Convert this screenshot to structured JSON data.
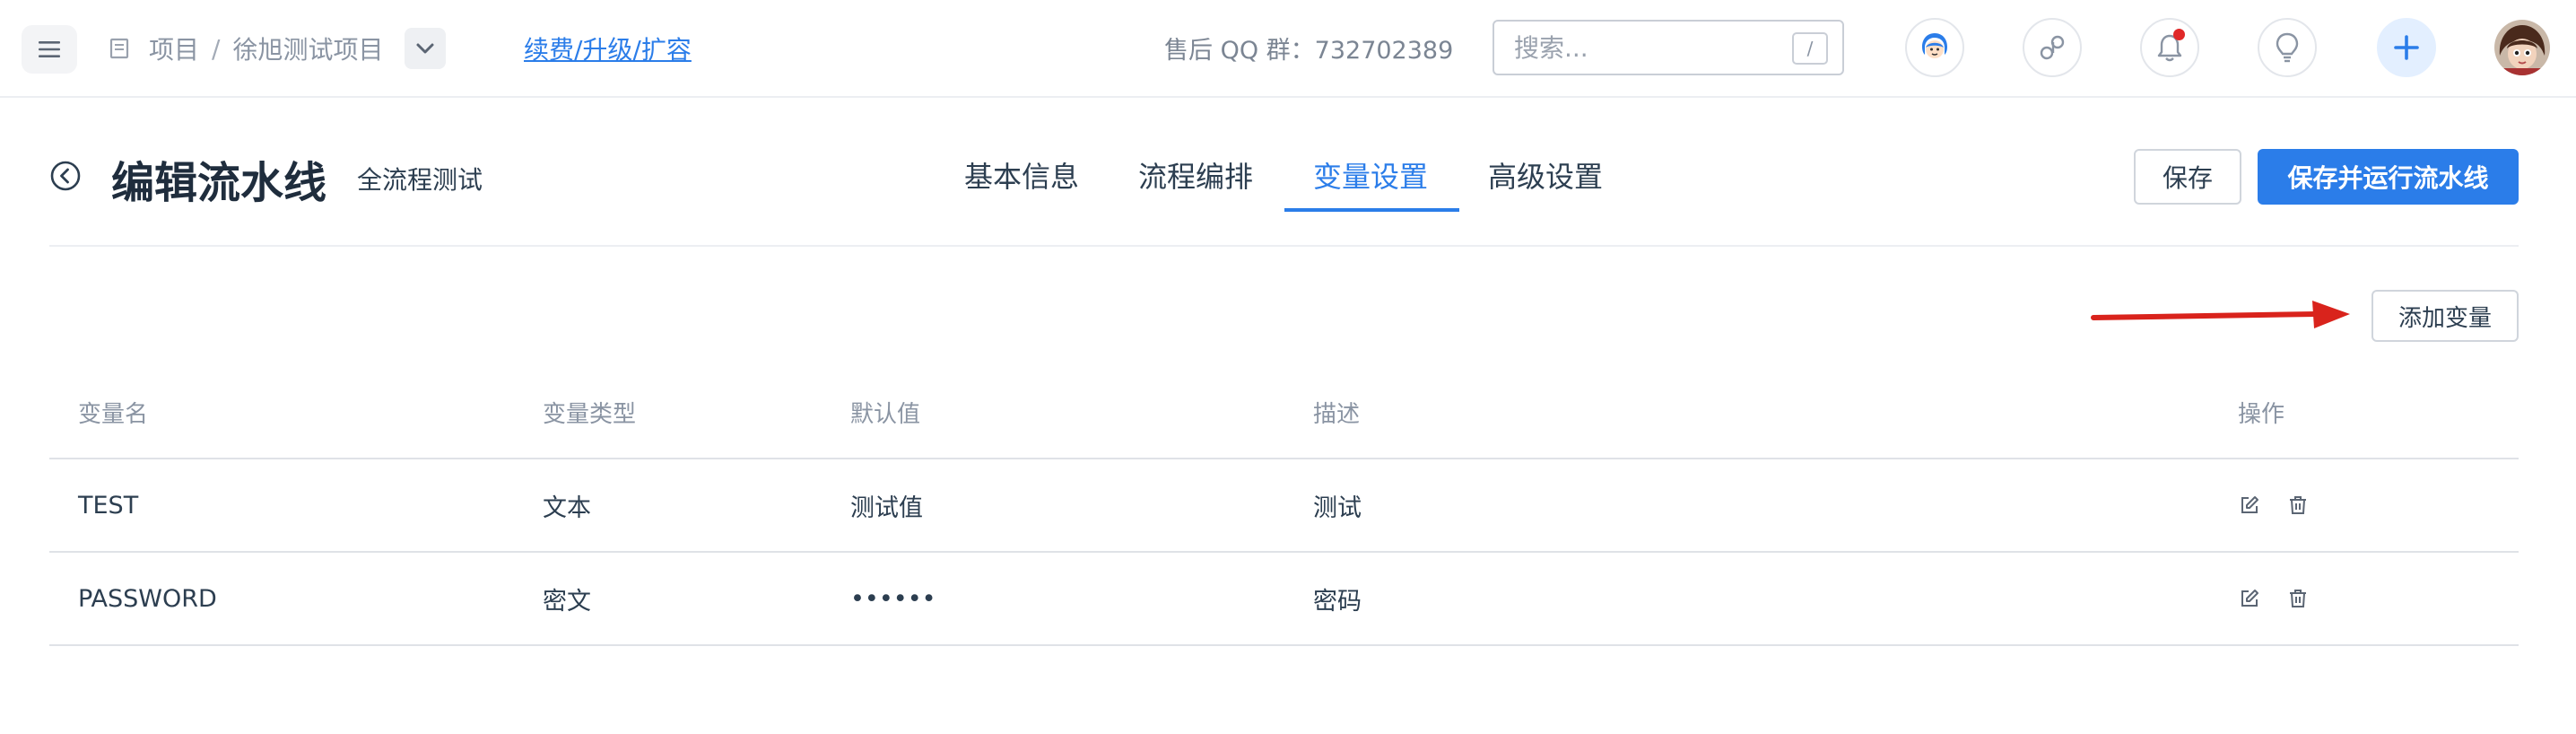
{
  "topbar": {
    "breadcrumb_root": "项目",
    "breadcrumb_sep": "/",
    "project_name": "徐旭测试项目",
    "renew_link": "续费/升级/扩容",
    "support_qq": "售后 QQ 群：732702389",
    "search_placeholder": "搜索...",
    "search_shortcut": "/",
    "icons": [
      "menu-icon",
      "project-icon",
      "chevron-down-icon",
      "customer-service-icon",
      "link-icon",
      "bell-icon",
      "lightbulb-icon",
      "plus-icon",
      "avatar"
    ],
    "notification_dot_color": "#e02828"
  },
  "header": {
    "title": "编辑流水线",
    "subtitle": "全流程测试",
    "tabs": [
      {
        "label": "基本信息",
        "active": false
      },
      {
        "label": "流程编排",
        "active": false
      },
      {
        "label": "变量设置",
        "active": true
      },
      {
        "label": "高级设置",
        "active": false
      }
    ],
    "save_label": "保存",
    "save_run_label": "保存并运行流水线"
  },
  "variables": {
    "add_label": "添加变量",
    "columns": [
      "变量名",
      "变量类型",
      "默认值",
      "描述",
      "操作"
    ],
    "rows": [
      {
        "name": "TEST",
        "type": "文本",
        "default": "测试值",
        "desc": "测试"
      },
      {
        "name": "PASSWORD",
        "type": "密文",
        "default": "••••••",
        "desc": "密码"
      }
    ]
  },
  "colors": {
    "accent": "#2b7de9",
    "annotation_arrow": "#d9231c"
  }
}
